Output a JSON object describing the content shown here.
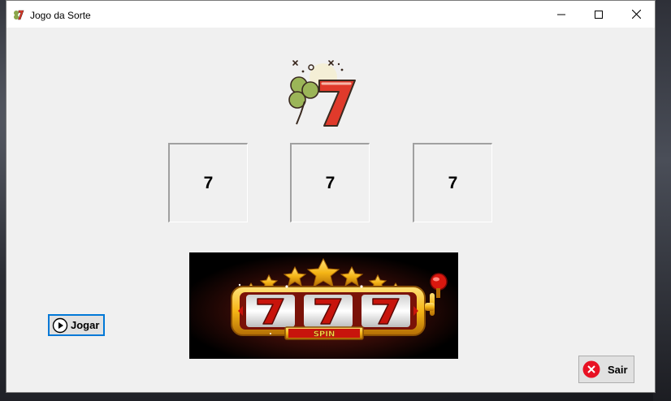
{
  "window": {
    "title": "Jogo da Sorte",
    "controls": {
      "minimize": "minimize-icon",
      "maximize": "maximize-icon",
      "close": "close-icon"
    }
  },
  "logo": {
    "glyph": "7",
    "icon": "clover-seven-icon"
  },
  "slots": [
    "7",
    "7",
    "7"
  ],
  "banner": {
    "reels": [
      "7",
      "7",
      "7"
    ],
    "label": "SPIN",
    "icon": "slot-machine-image"
  },
  "buttons": {
    "play_label": "Jogar",
    "play_icon": "play-icon",
    "exit_label": "Sair",
    "exit_icon": "close-circle-icon"
  },
  "colors": {
    "window_bg": "#f0f0f0",
    "focus_border": "#0078d7",
    "exit_red": "#e81123",
    "seven_red": "#e03a2b"
  }
}
